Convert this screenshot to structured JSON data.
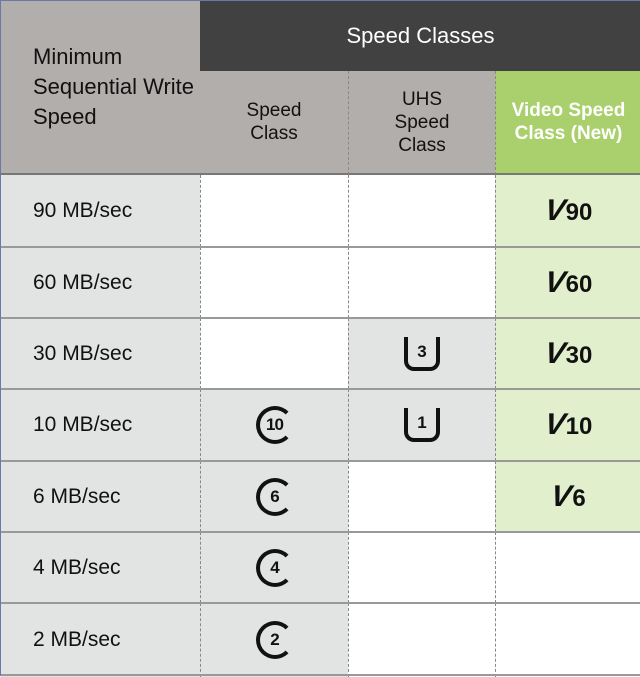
{
  "header": {
    "min_speed": "Minimum Sequential Write Speed",
    "speed_classes": "Speed Classes",
    "speed_class": "Speed Class",
    "uhs_speed_class": "UHS Speed Class",
    "video_speed_class": "Video Speed Class (New)"
  },
  "colors": {
    "header_dark": "#414141",
    "header_gray": "#b2aeac",
    "video_green": "#a9d06c",
    "video_light": "#e1efcd",
    "cell_gray": "#e2e3e3"
  },
  "rows": [
    {
      "speed": "90 MB/sec",
      "speed_class": "",
      "uhs": "",
      "video": "90"
    },
    {
      "speed": "60 MB/sec",
      "speed_class": "",
      "uhs": "",
      "video": "60"
    },
    {
      "speed": "30 MB/sec",
      "speed_class": "",
      "uhs": "3",
      "video": "30"
    },
    {
      "speed": "10 MB/sec",
      "speed_class": "10",
      "uhs": "1",
      "video": "10"
    },
    {
      "speed": "6 MB/sec",
      "speed_class": "6",
      "uhs": "",
      "video": "6"
    },
    {
      "speed": "4 MB/sec",
      "speed_class": "4",
      "uhs": "",
      "video": ""
    },
    {
      "speed": "2 MB/sec",
      "speed_class": "2",
      "uhs": "",
      "video": ""
    }
  ],
  "video_prefix": "V"
}
